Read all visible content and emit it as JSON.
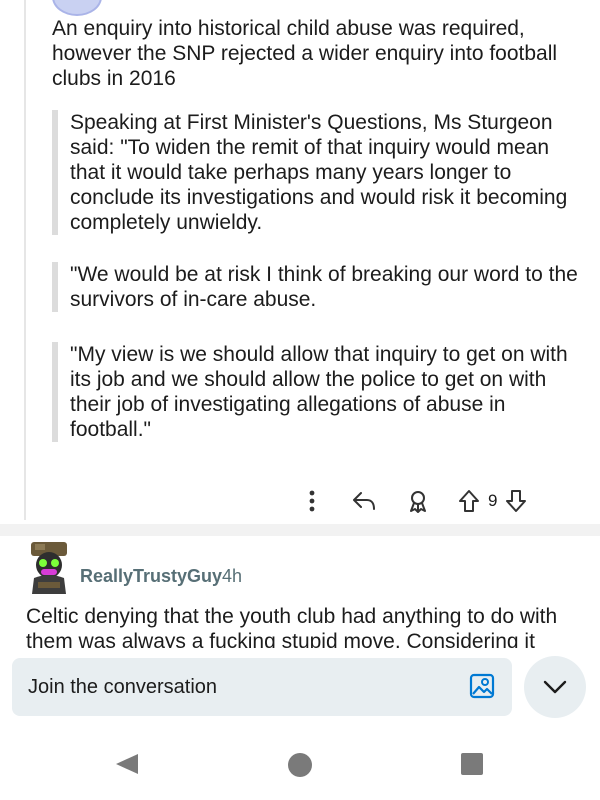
{
  "comment1": {
    "intro": "An enquiry into historical child abuse was required, however the SNP rejected a wider enquiry into football clubs in 2016",
    "quotes": [
      "Speaking at First Minister's Questions, Ms Sturgeon said: \"To widen the remit of that inquiry would mean that it would take perhaps many years longer to conclude its investigations and would risk it becoming completely unwieldy.",
      "\"We would be at risk I think of breaking our word to the survivors of in-care abuse.",
      "\"My view is we should allow that inquiry to get on with its job and we should allow the police to get on with their job of investigating allegations of abuse in football.\""
    ],
    "actions": {
      "more_icon": "more-vertical-icon",
      "reply_icon": "reply-icon",
      "award_icon": "award-icon",
      "upvote_icon": "upvote-icon",
      "downvote_icon": "downvote-icon",
      "vote_count": "9"
    }
  },
  "comment2": {
    "username": "ReallyTrustyGuy",
    "time": "4h",
    "body": "Celtic denying that the youth club had anything to do with them was always a fucking stupid move. Considering it"
  },
  "composer": {
    "placeholder": "Join the conversation",
    "image_icon": "image-icon",
    "collapse_icon": "chevron-down-icon"
  },
  "colors": {
    "accent": "#0079d3",
    "meta": "#576f76",
    "input_bg": "#e8eef1"
  }
}
